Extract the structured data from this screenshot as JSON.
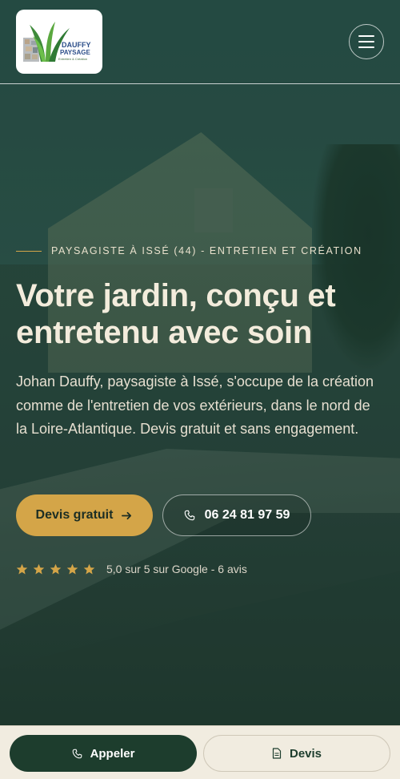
{
  "brand": {
    "logo_line1": "DAUFFY",
    "logo_line2": "PAYSAGE",
    "logo_tagline": "Entretien & Création",
    "colors": {
      "accent": "#d4a548",
      "dark_green": "#1d3d2d",
      "cream": "#f1ece0"
    }
  },
  "header": {
    "menu_icon": "hamburger-icon"
  },
  "hero": {
    "eyebrow": "PAYSAGISTE À ISSÉ (44) - ENTRETIEN ET CRÉATION",
    "headline_line1": "Votre jardin, conçu et",
    "headline_line2": "entretenu avec soin",
    "subtext": "Johan Dauffy, paysagiste à Issé, s'occupe de la création comme de l'entretien de vos extérieurs, dans le nord de la Loire-Atlantique. Devis gratuit et sans engagement.",
    "cta_primary": "Devis gratuit",
    "cta_primary_icon": "arrow-right-icon",
    "cta_phone": "06 24 81 97 59",
    "cta_phone_icon": "phone-icon",
    "rating_stars": 5,
    "rating_text": "5,0 sur 5 sur Google - 6 avis"
  },
  "bottom_bar": {
    "call_label": "Appeler",
    "call_icon": "phone-icon",
    "devis_label": "Devis",
    "devis_icon": "document-icon"
  }
}
